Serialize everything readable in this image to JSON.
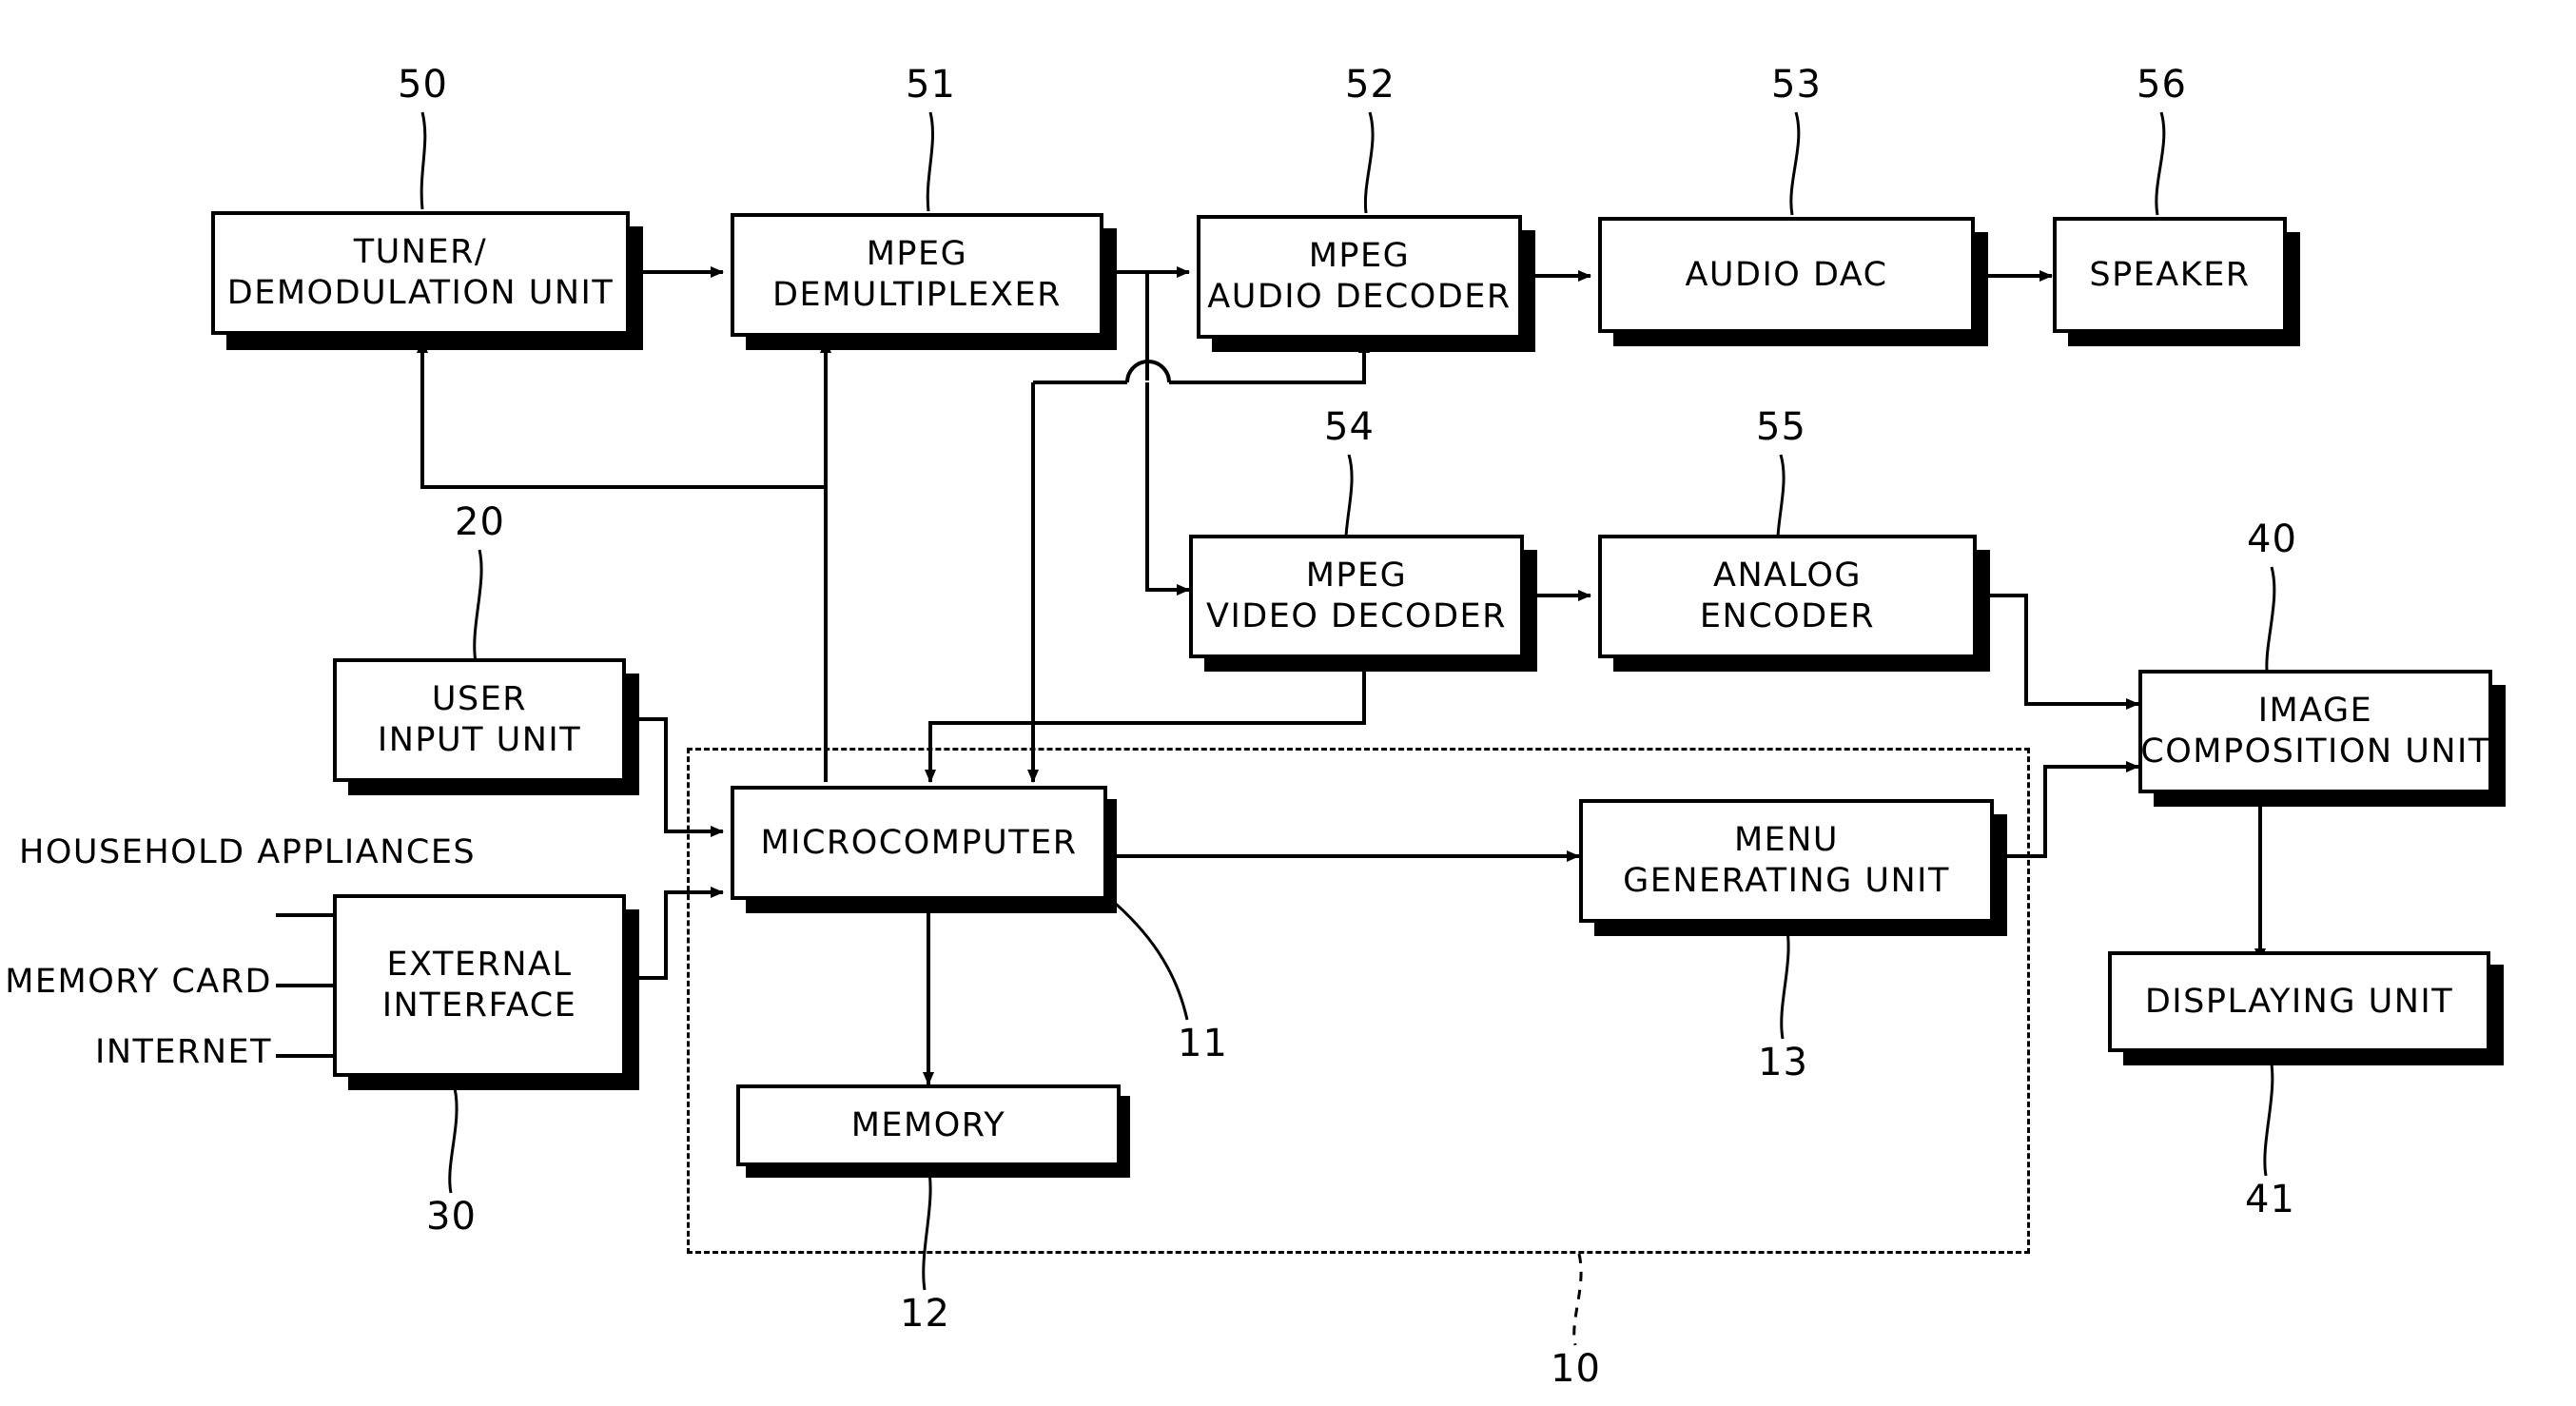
{
  "diagram": {
    "title": "Digital broadcast receiver block diagram",
    "line_color": "#000000",
    "background_color": "#ffffff"
  },
  "blocks": {
    "tuner": {
      "line1": "TUNER/",
      "line2": "DEMODULATION UNIT"
    },
    "demux": {
      "line1": "MPEG",
      "line2": "DEMULTIPLEXER"
    },
    "audio_decoder": {
      "line1": "MPEG",
      "line2": "AUDIO DECODER"
    },
    "audio_dac": {
      "line1": "AUDIO DAC"
    },
    "speaker": {
      "line1": "SPEAKER"
    },
    "video_decoder": {
      "line1": "MPEG",
      "line2": "VIDEO DECODER"
    },
    "analog_encoder": {
      "line1": "ANALOG",
      "line2": "ENCODER"
    },
    "image_composition": {
      "line1": "IMAGE",
      "line2": "COMPOSITION UNIT"
    },
    "displaying": {
      "line1": "DISPLAYING UNIT"
    },
    "user_input": {
      "line1": "USER",
      "line2": "INPUT UNIT"
    },
    "external_interface": {
      "line1": "EXTERNAL",
      "line2": "INTERFACE"
    },
    "microcomputer": {
      "line1": "MICROCOMPUTER"
    },
    "memory": {
      "line1": "MEMORY"
    },
    "menu_generating": {
      "line1": "MENU",
      "line2": "GENERATING UNIT"
    }
  },
  "external_inputs": {
    "household_line1": "HOUSEHOLD",
    "household_line2": "APPLIANCES",
    "memory_card": "MEMORY CARD",
    "internet": "INTERNET"
  },
  "reference_numerals": {
    "tuner": "50",
    "demux": "51",
    "audio_decoder": "52",
    "audio_dac": "53",
    "speaker": "56",
    "video_decoder": "54",
    "analog_encoder": "55",
    "image_composition": "40",
    "displaying": "41",
    "user_input": "20",
    "external_interface": "30",
    "microcomputer": "11",
    "memory": "12",
    "menu_generating": "13",
    "control_unit": "10"
  }
}
